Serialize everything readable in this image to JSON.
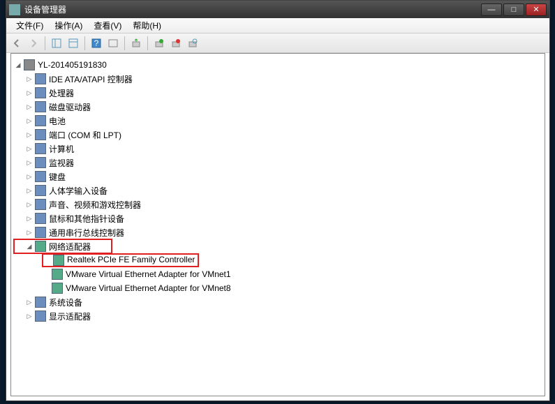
{
  "window": {
    "title": "设备管理器",
    "buttons": {
      "min": "—",
      "max": "□",
      "close": "✕"
    }
  },
  "menu": {
    "file": "文件(F)",
    "action": "操作(A)",
    "view": "查看(V)",
    "help": "帮助(H)"
  },
  "tree": {
    "root": "YL-201405191830",
    "cat": {
      "ide": "IDE ATA/ATAPI 控制器",
      "cpu": "处理器",
      "disk": "磁盘驱动器",
      "battery": "电池",
      "ports": "端口 (COM 和 LPT)",
      "computer": "计算机",
      "monitor": "监视器",
      "keyboard": "键盘",
      "hid": "人体学输入设备",
      "sound": "声音、视频和游戏控制器",
      "mouse": "鼠标和其他指针设备",
      "usb": "通用串行总线控制器",
      "network": "网络适配器",
      "system": "系统设备",
      "display": "显示适配器"
    },
    "net_children": {
      "realtek": "Realtek PCIe FE Family Controller",
      "vmnet1": "VMware Virtual Ethernet Adapter for VMnet1",
      "vmnet8": "VMware Virtual Ethernet Adapter for VMnet8"
    }
  },
  "glyph": {
    "collapsed": "▷",
    "expanded": "◢"
  }
}
